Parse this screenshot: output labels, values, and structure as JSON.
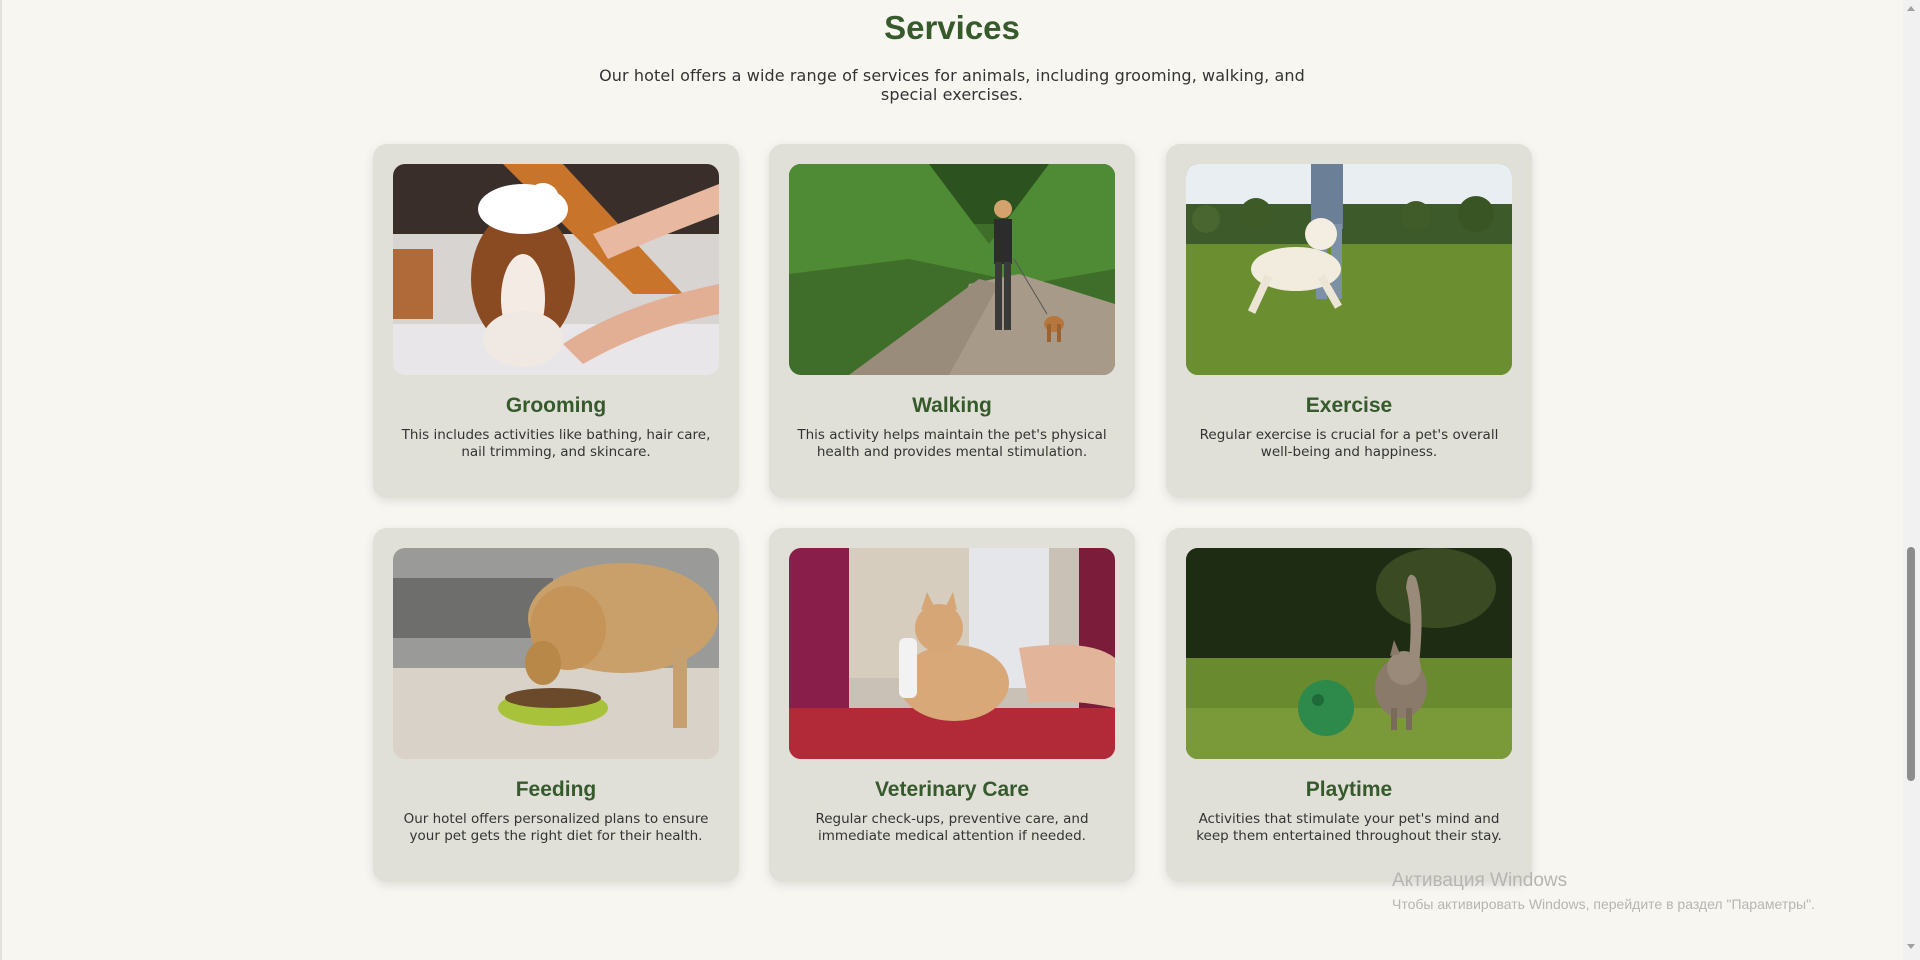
{
  "services": {
    "title": "Services",
    "subtitle": "Our hotel offers a wide range of services for animals, including grooming, walking, and special exercises.",
    "cards": [
      {
        "title": "Grooming",
        "description": "This includes activities like bathing, hair care, nail trimming, and skincare.",
        "image": "dog-bath-photo"
      },
      {
        "title": "Walking",
        "description": "This activity helps maintain the pet's physical health and provides mental stimulation.",
        "image": "woman-walking-dog-photo"
      },
      {
        "title": "Exercise",
        "description": "Regular exercise is crucial for a pet's overall well-being and happiness.",
        "image": "dog-running-park-photo"
      },
      {
        "title": "Feeding",
        "description": "Our hotel offers personalized plans to ensure your pet gets the right diet for their health.",
        "image": "dog-eating-bowl-photo"
      },
      {
        "title": "Veterinary Care",
        "description": "Regular check-ups, preventive care, and immediate medical attention if needed.",
        "image": "cat-vet-exam-photo"
      },
      {
        "title": "Playtime",
        "description": "Activities that stimulate your pet's mind and keep them entertained throughout their stay.",
        "image": "kitten-ball-photo"
      }
    ]
  },
  "watermark": {
    "title": "Активация Windows",
    "subtitle": "Чтобы активировать Windows, перейдите в раздел \"Параметры\"."
  },
  "colors": {
    "page_bg": "#f7f6f1",
    "card_bg": "#e0e0d8",
    "heading": "#365a2c",
    "text": "#333333"
  }
}
